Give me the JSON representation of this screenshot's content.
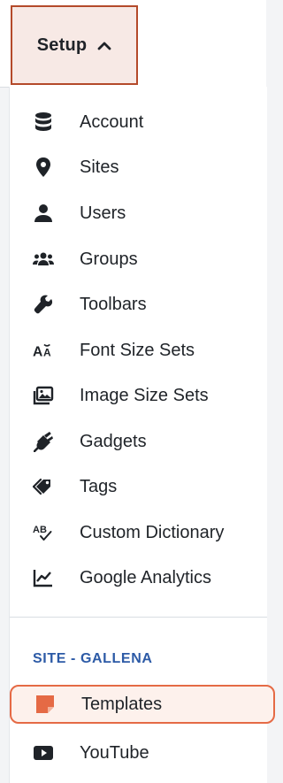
{
  "header": {
    "setup_label": "Setup"
  },
  "menu": {
    "items": [
      {
        "label": "Account",
        "icon": "database-icon"
      },
      {
        "label": "Sites",
        "icon": "map-pin-icon"
      },
      {
        "label": "Users",
        "icon": "user-icon"
      },
      {
        "label": "Groups",
        "icon": "users-group-icon"
      },
      {
        "label": "Toolbars",
        "icon": "wrench-icon"
      },
      {
        "label": "Font Size Sets",
        "icon": "font-size-icon"
      },
      {
        "label": "Image Size Sets",
        "icon": "image-icon"
      },
      {
        "label": "Gadgets",
        "icon": "plug-icon"
      },
      {
        "label": "Tags",
        "icon": "tags-icon"
      },
      {
        "label": "Custom Dictionary",
        "icon": "spellcheck-icon"
      },
      {
        "label": "Google Analytics",
        "icon": "chart-line-icon"
      }
    ],
    "site_section": {
      "title": "SITE - GALLENA",
      "items": [
        {
          "label": "Templates",
          "icon": "template-icon",
          "active": true,
          "accent": "#e56a45"
        },
        {
          "label": "YouTube",
          "icon": "youtube-icon"
        }
      ]
    }
  }
}
